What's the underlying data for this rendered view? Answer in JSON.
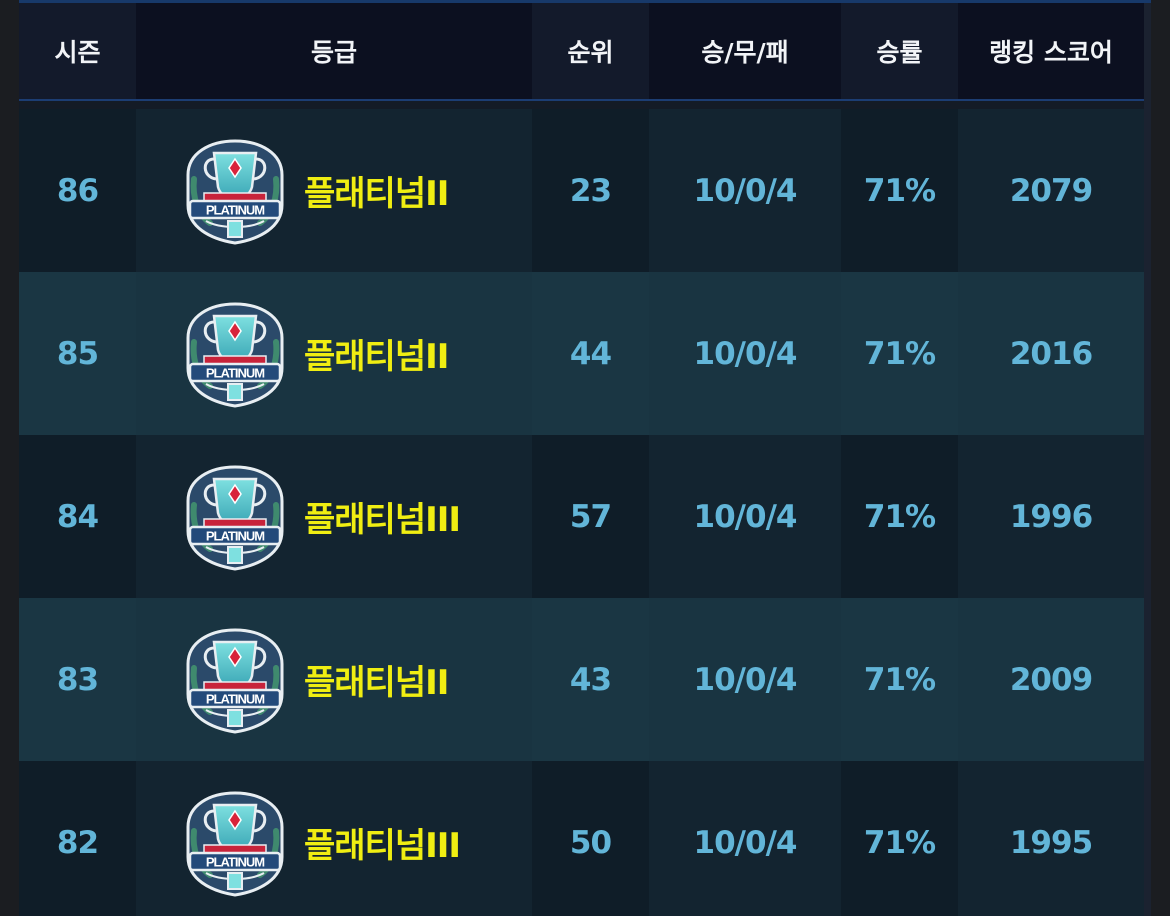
{
  "table": {
    "columns": [
      "시즌",
      "등급",
      "순위",
      "승/무/패",
      "승률",
      "랭킹 스코어"
    ],
    "rows": [
      {
        "season": "86",
        "tier": "플래티넘II",
        "rank": "23",
        "record": "10/0/4",
        "win_rate": "71%",
        "score": "2079"
      },
      {
        "season": "85",
        "tier": "플래티넘II",
        "rank": "44",
        "record": "10/0/4",
        "win_rate": "71%",
        "score": "2016"
      },
      {
        "season": "84",
        "tier": "플래티넘III",
        "rank": "57",
        "record": "10/0/4",
        "win_rate": "71%",
        "score": "1996"
      },
      {
        "season": "83",
        "tier": "플래티넘II",
        "rank": "43",
        "record": "10/0/4",
        "win_rate": "71%",
        "score": "2009"
      },
      {
        "season": "82",
        "tier": "플래티넘III",
        "rank": "50",
        "record": "10/0/4",
        "win_rate": "71%",
        "score": "1995"
      }
    ],
    "badge": {
      "icon": "platinum-trophy-icon",
      "label": "PLATINUM"
    }
  },
  "colors": {
    "tier_text": "#f0ee12",
    "value_text": "#62b5d8",
    "header_text": "#f2f4f7",
    "row_dark": "#132430",
    "row_light": "#193441"
  }
}
